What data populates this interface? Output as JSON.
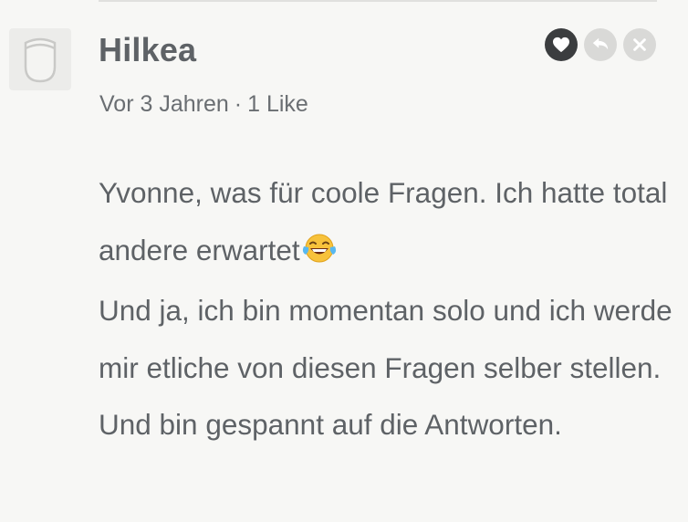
{
  "comment": {
    "author": "Hilkea",
    "age": "Vor 3 Jahren",
    "separator": "·",
    "likes": "1 Like",
    "paragraphs": [
      "Yvonne, was für coole Fragen. Ich hatte total andere erwartet",
      "Und ja, ich bin momentan solo und ich werde mir etliche von diesen Fragen selber stellen. Und bin gespannt auf die Antworten."
    ],
    "emoji": "face-with-tears-of-joy"
  },
  "actions": {
    "like_icon": "heart-icon",
    "reply_icon": "reply-icon",
    "delete_icon": "close-icon"
  },
  "colors": {
    "background": "#f7f7f5",
    "text": "#5e6266",
    "like_button": "#3b3d3f",
    "inactive_button": "#d9d9d7"
  }
}
